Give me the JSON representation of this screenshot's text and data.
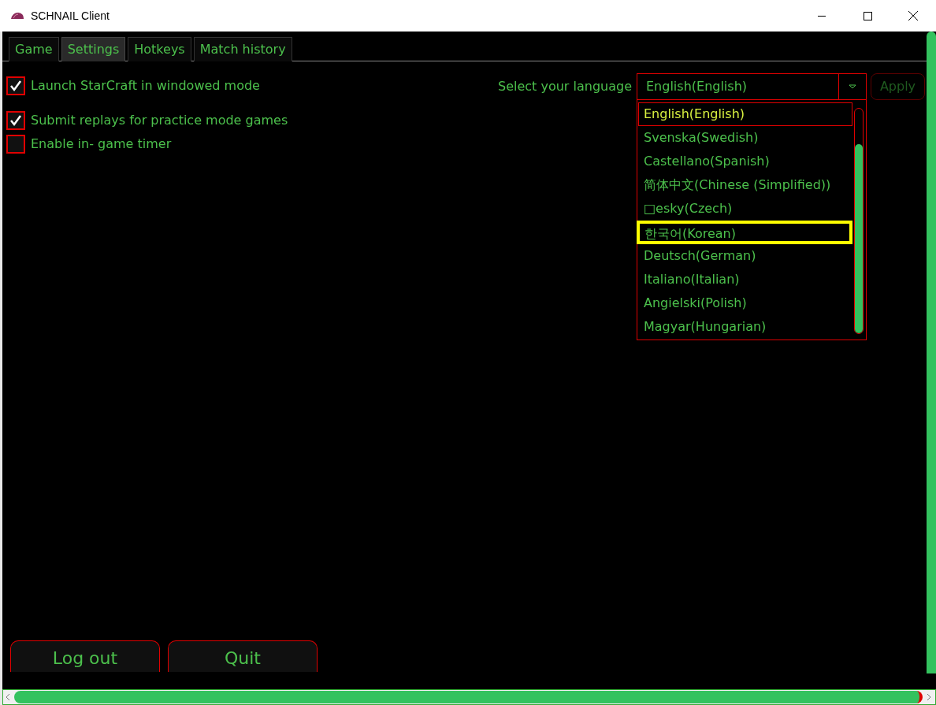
{
  "window": {
    "title": "SCHNAIL Client"
  },
  "tabs": [
    {
      "label": "Game",
      "selected": false
    },
    {
      "label": "Settings",
      "selected": true
    },
    {
      "label": "Hotkeys",
      "selected": false
    },
    {
      "label": "Match history",
      "selected": false
    }
  ],
  "options": [
    {
      "label": "Launch StarCraft in windowed mode",
      "checked": true
    },
    {
      "label": "Submit replays for practice mode games",
      "checked": true
    },
    {
      "label": "Enable in- game timer",
      "checked": false
    }
  ],
  "language": {
    "label": "Select your language",
    "value": "English(English)",
    "apply": "Apply",
    "apply_disabled": true,
    "items": [
      {
        "label": "English(English)",
        "selected": true,
        "hovered": false
      },
      {
        "label": "Svenska(Swedish)",
        "selected": false,
        "hovered": false
      },
      {
        "label": "Castellano(Spanish)",
        "selected": false,
        "hovered": false
      },
      {
        "label": "简体中文(Chinese (Simplified))",
        "selected": false,
        "hovered": false
      },
      {
        "label": "□esky(Czech)",
        "selected": false,
        "hovered": false
      },
      {
        "label": "한국어(Korean)",
        "selected": false,
        "hovered": true
      },
      {
        "label": "Deutsch(German)",
        "selected": false,
        "hovered": false
      },
      {
        "label": "Italiano(Italian)",
        "selected": false,
        "hovered": false
      },
      {
        "label": "Angielski(Polish)",
        "selected": false,
        "hovered": false
      },
      {
        "label": "Magyar(Hungarian)",
        "selected": false,
        "hovered": false
      }
    ]
  },
  "buttons": [
    "Log out",
    "Quit"
  ]
}
